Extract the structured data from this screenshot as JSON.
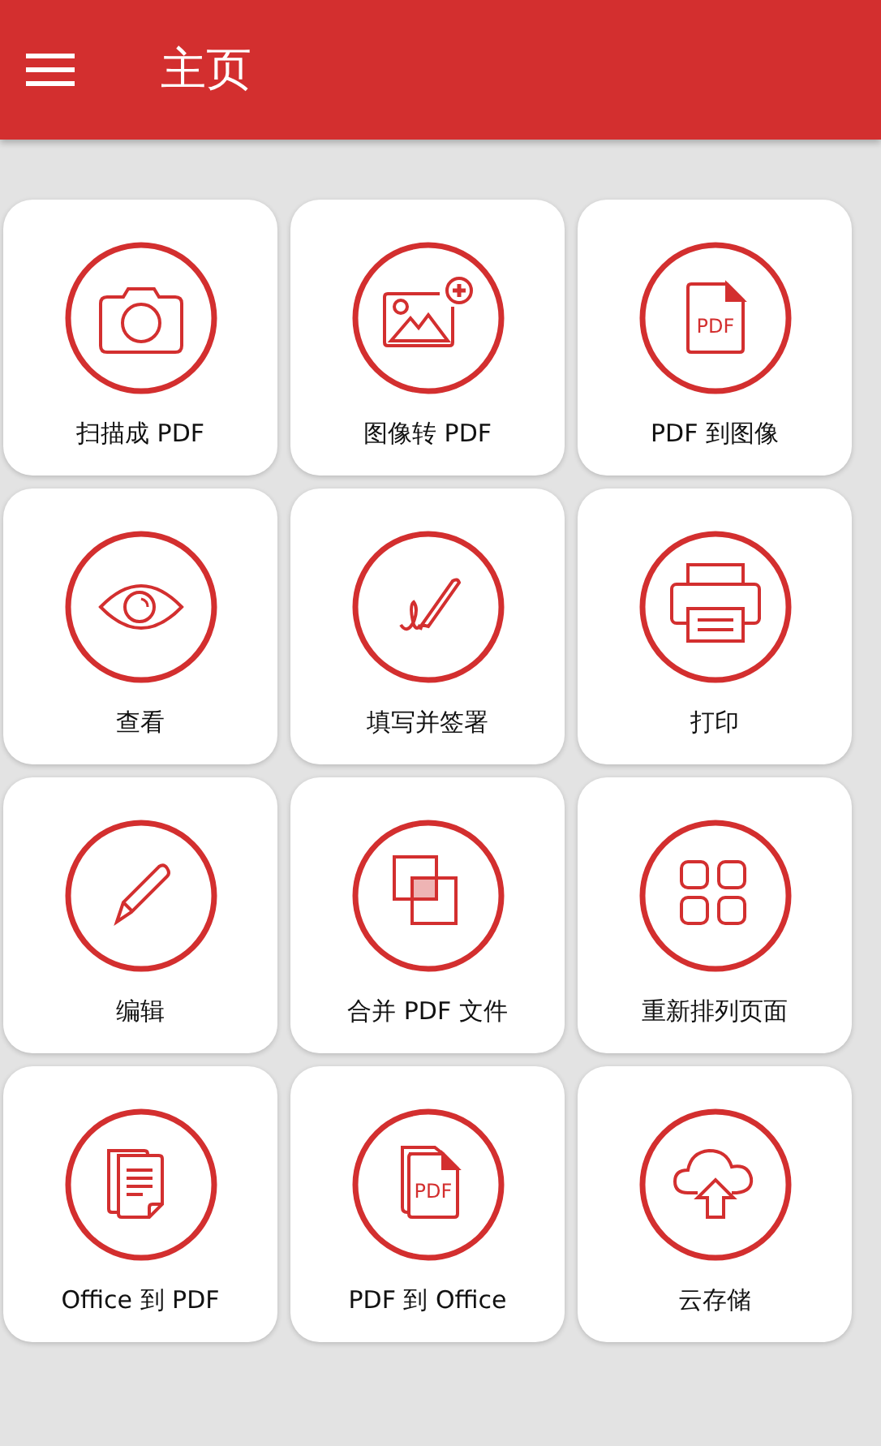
{
  "app_bar": {
    "title": "主页"
  },
  "tiles": [
    {
      "kind": "camera",
      "label": "扫描成 PDF"
    },
    {
      "kind": "image_add",
      "label": "图像转 PDF"
    },
    {
      "kind": "pdf_file",
      "label": "PDF 到图像",
      "icon_text": "PDF"
    },
    {
      "kind": "eye",
      "label": "查看"
    },
    {
      "kind": "signature",
      "label": "填写并签署"
    },
    {
      "kind": "printer",
      "label": "打印"
    },
    {
      "kind": "pencil",
      "label": "编辑"
    },
    {
      "kind": "merge",
      "label": "合并 PDF 文件"
    },
    {
      "kind": "grid",
      "label": "重新排列页面"
    },
    {
      "kind": "documents",
      "label": "Office 到 PDF"
    },
    {
      "kind": "pdf_files",
      "label": "PDF 到 Office",
      "icon_text": "PDF"
    },
    {
      "kind": "cloud",
      "label": "云存储"
    }
  ]
}
